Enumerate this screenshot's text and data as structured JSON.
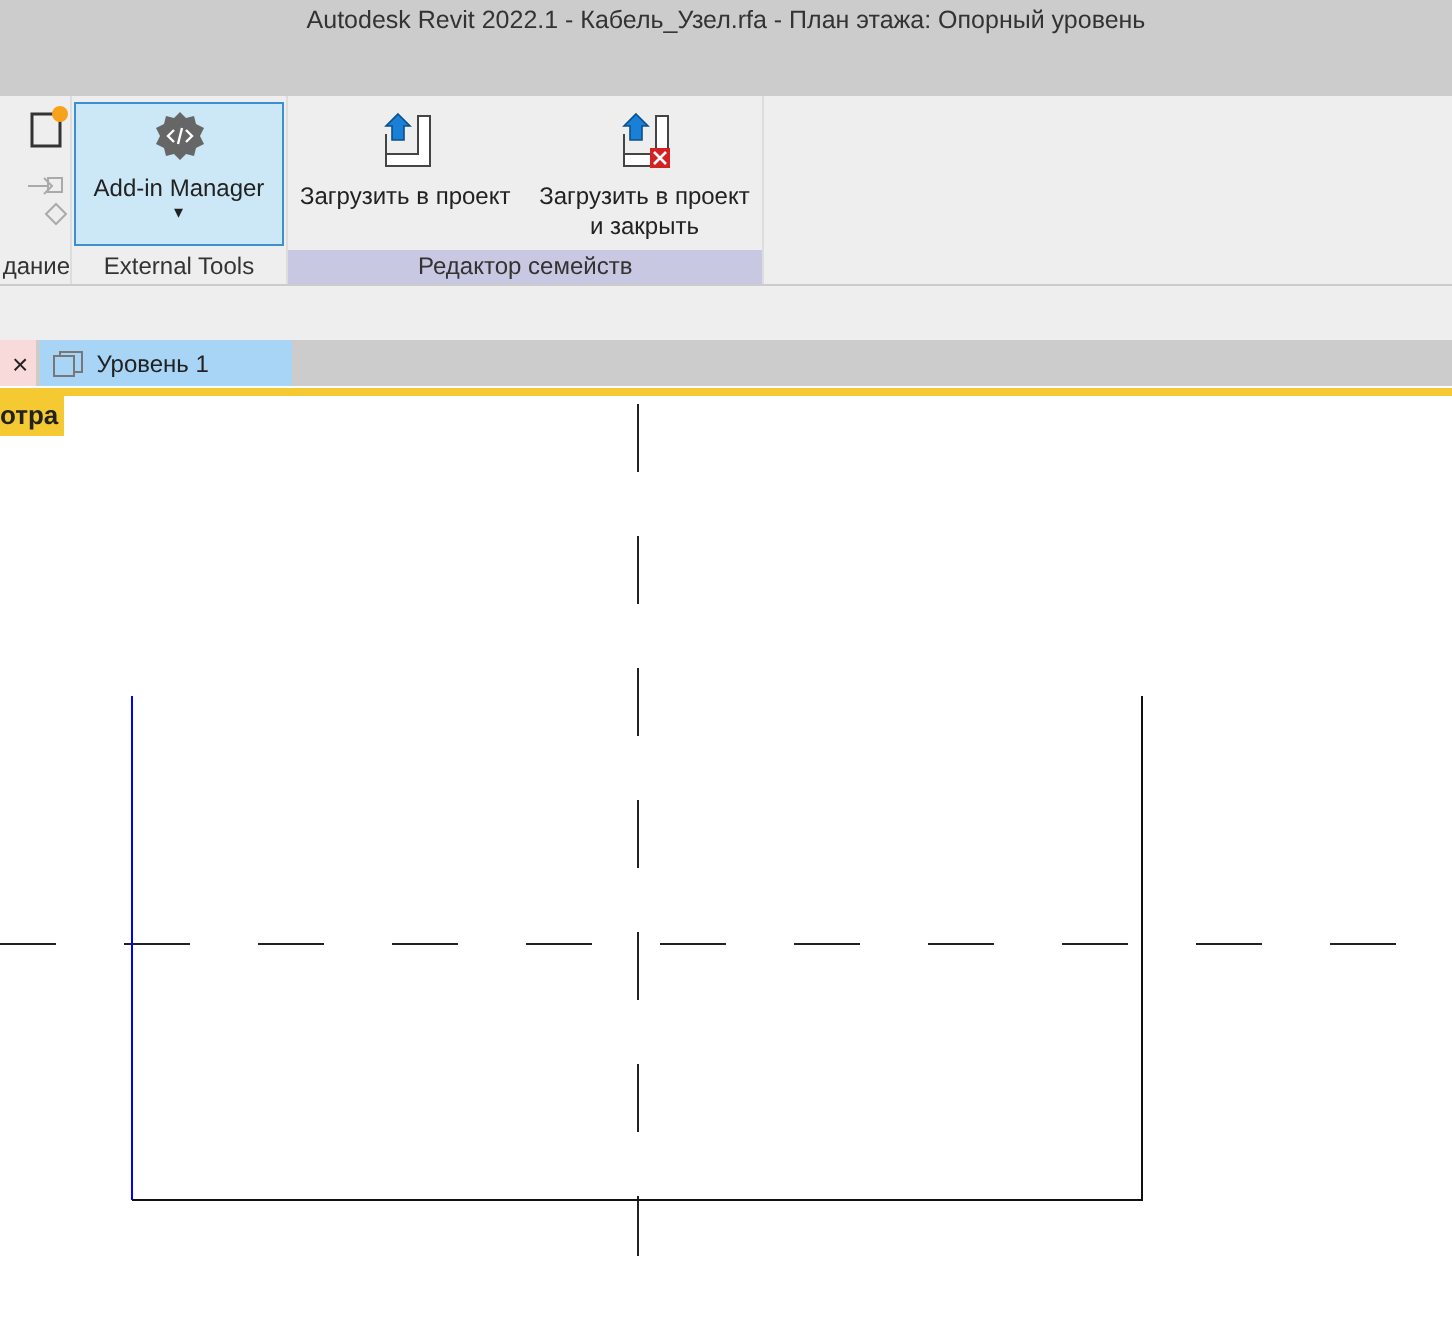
{
  "window": {
    "title": "Autodesk Revit 2022.1 - Кабель_Узел.rfa - План этажа: Опорный уровень"
  },
  "ribbon": {
    "panels": [
      {
        "kind": "partial",
        "label": "дание"
      },
      {
        "kind": "tools",
        "label": "External Tools",
        "highlighted": false,
        "buttons": [
          {
            "kind": "addin",
            "label": "Add-in Manager",
            "dropdown": "▾",
            "selected": true
          }
        ]
      },
      {
        "kind": "tools",
        "label": "Редактор семейств",
        "highlighted": true,
        "buttons": [
          {
            "kind": "load",
            "label": "Загрузить в проект",
            "selected": false
          },
          {
            "kind": "load-close",
            "label": "Загрузить в проект и закрыть",
            "selected": false
          }
        ]
      }
    ]
  },
  "tabs": [
    {
      "close": "×",
      "selected": false
    },
    {
      "label": "Уровень 1",
      "selected": true
    }
  ],
  "view": {
    "badge": "отра"
  }
}
